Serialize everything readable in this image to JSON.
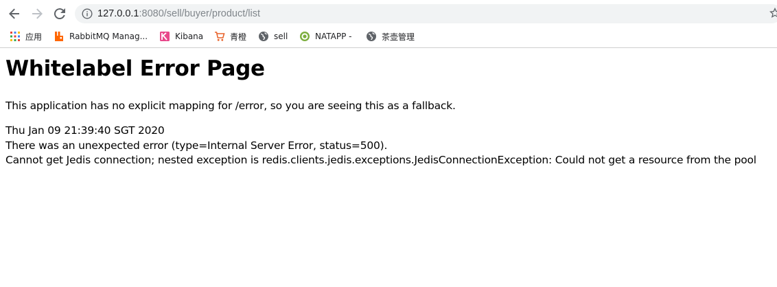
{
  "browser": {
    "url_host": "127.0.0.1",
    "url_rest": ":8080/sell/buyer/product/list"
  },
  "bookmarks": [
    {
      "label": "应用",
      "icon": "apps-grid-icon"
    },
    {
      "label": "RabbitMQ Manag...",
      "icon": "rabbitmq-icon"
    },
    {
      "label": "Kibana",
      "icon": "kibana-icon"
    },
    {
      "label": "青橙",
      "icon": "shopping-cart-icon"
    },
    {
      "label": "sell",
      "icon": "globe-icon"
    },
    {
      "label": "NATAPP -",
      "icon": "natapp-icon"
    },
    {
      "label": "茶壶管理",
      "icon": "globe-icon"
    }
  ],
  "page": {
    "title": "Whitelabel Error Page",
    "message": "This application has no explicit mapping for /error, so you are seeing this as a fallback.",
    "timestamp": "Thu Jan 09 21:39:40 SGT 2020",
    "error_line": "There was an unexpected error (type=Internal Server Error, status=500).",
    "exception_line": "Cannot get Jedis connection; nested exception is redis.clients.jedis.exceptions.JedisConnectionException: Could not get a resource from the pool"
  },
  "colors": {
    "omnibox_bg": "#f1f3f4",
    "rabbitmq_orange": "#ff6600",
    "kibana_pink": "#e8488b",
    "cart_orange": "#e8642c"
  }
}
